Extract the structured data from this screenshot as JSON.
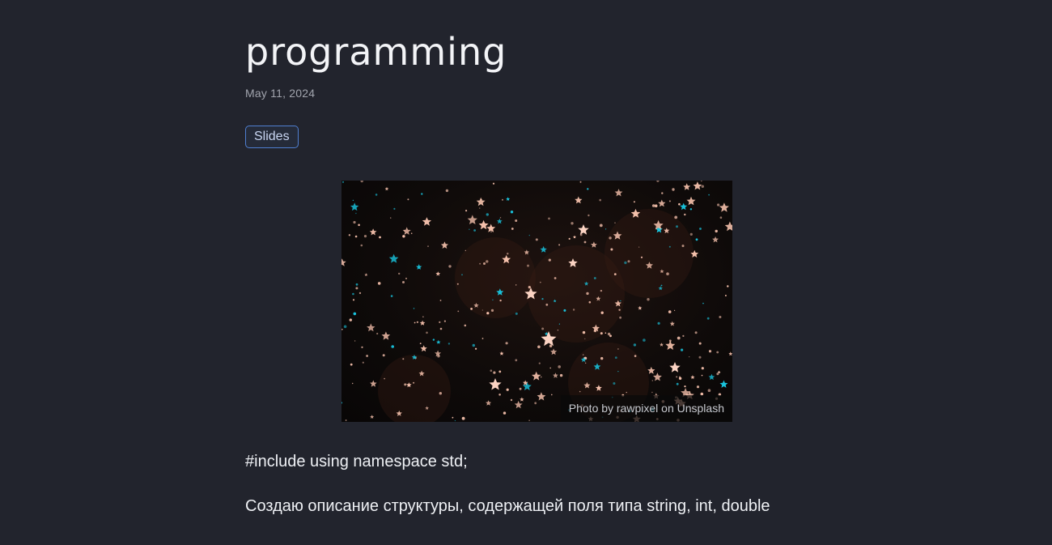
{
  "post": {
    "title": "programming",
    "date": "May 11, 2024",
    "tag": "Slides",
    "image": {
      "caption": "Photo by rawpixel on Unsplash"
    },
    "paragraphs": [
      "#include using namespace std;",
      "Создаю описание структуры, содержащей поля типа string, int, double"
    ]
  },
  "colors": {
    "background": "#22242d",
    "tag_border": "#4f7fd1",
    "star_warm": "#f7c2ad",
    "star_cyan": "#19c6e0"
  }
}
